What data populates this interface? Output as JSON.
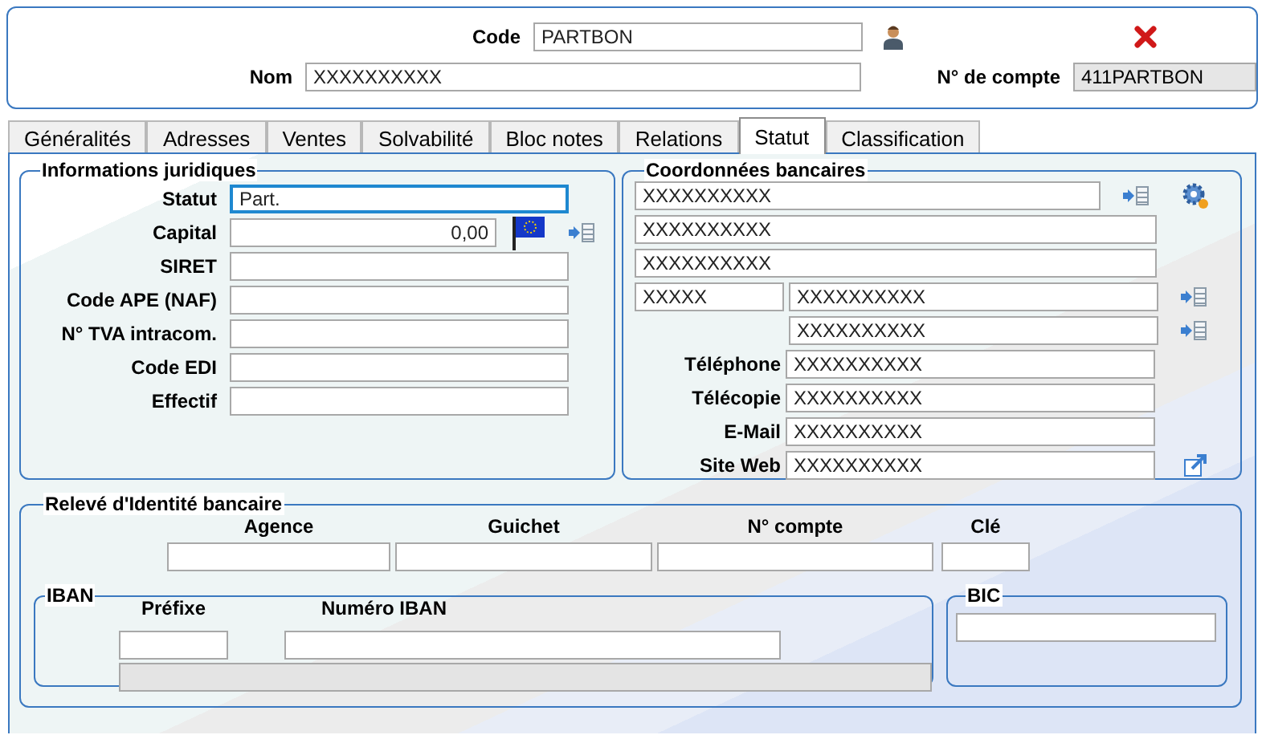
{
  "header": {
    "code": {
      "label": "Code",
      "value": "PARTBON"
    },
    "nom": {
      "label": "Nom",
      "value": "XXXXXXXXXX"
    },
    "compte": {
      "label": "N° de compte",
      "value": "411PARTBON",
      "disabled": true
    }
  },
  "tabs": [
    {
      "label": "Généralités",
      "selected": false
    },
    {
      "label": "Adresses",
      "selected": false
    },
    {
      "label": "Ventes",
      "selected": false
    },
    {
      "label": "Solvabilité",
      "selected": false
    },
    {
      "label": "Bloc notes",
      "selected": false
    },
    {
      "label": "Relations",
      "selected": false
    },
    {
      "label": "Statut",
      "selected": true
    },
    {
      "label": "Classification",
      "selected": false
    }
  ],
  "juridique": {
    "title": "Informations juridiques",
    "fields": [
      {
        "label": "Statut",
        "value": "Part.",
        "kind": "text",
        "focused": true
      },
      {
        "label": "Capital",
        "value": "0,00",
        "kind": "amount",
        "focused": false
      },
      {
        "label": "SIRET",
        "kind": "text",
        "focused": false
      },
      {
        "label": "Code APE (NAF)",
        "kind": "text",
        "focused": false
      },
      {
        "label": "N° TVA intracom.",
        "kind": "text",
        "focused": false
      },
      {
        "label": "Code EDI",
        "kind": "text",
        "focused": false
      },
      {
        "label": "Effectif",
        "kind": "text",
        "focused": false
      }
    ]
  },
  "bancaires": {
    "title": "Coordonnées bancaires",
    "address": [
      "XXXXXXXXXX",
      "XXXXXXXXXX",
      "XXXXXXXXXX"
    ],
    "postcode": "XXXXX",
    "city": "XXXXXXXXXX",
    "city_line2": "XXXXXXXXXX",
    "contacts": [
      {
        "label": "Téléphone",
        "value": "XXXXXXXXXX"
      },
      {
        "label": "Télécopie",
        "value": "XXXXXXXXXX"
      },
      {
        "label": "E-Mail",
        "value": "XXXXXXXXXX"
      },
      {
        "label": "Site Web",
        "value": "XXXXXXXXXX"
      }
    ]
  },
  "rib": {
    "title": "Relevé d'Identité bancaire",
    "columns": [
      "Agence",
      "Guichet",
      "N° compte",
      "Clé"
    ],
    "iban": {
      "title": "IBAN",
      "prefix_label": "Préfixe",
      "number_label": "Numéro IBAN"
    },
    "bic": {
      "title": "BIC"
    }
  }
}
